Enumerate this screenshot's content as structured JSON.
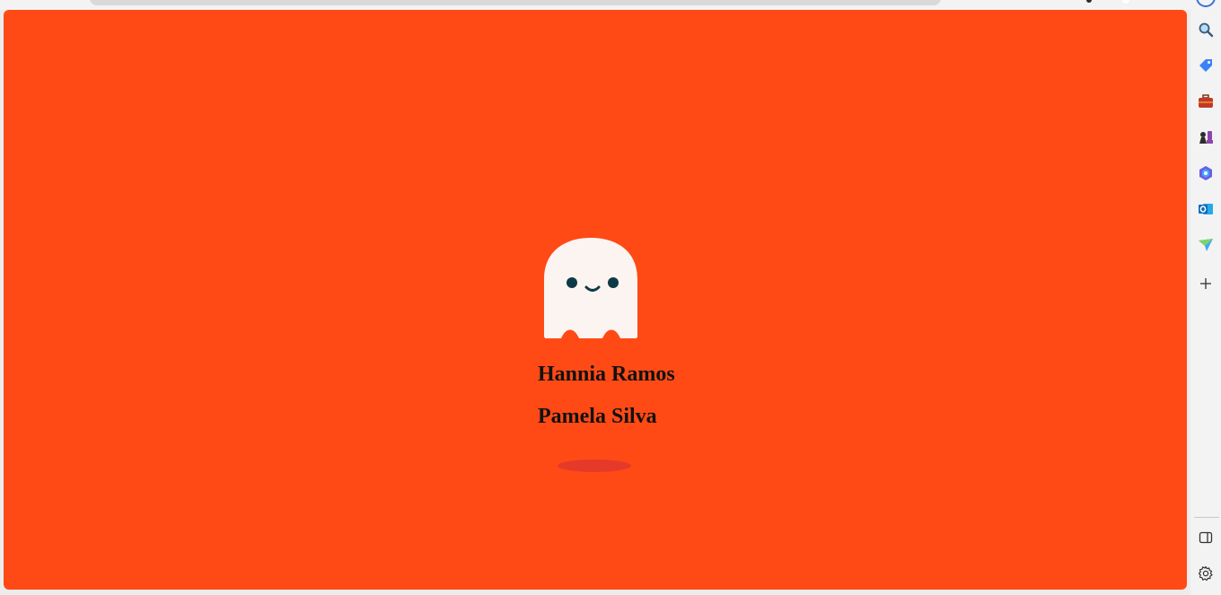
{
  "page": {
    "background_color": "#ff4a16",
    "ghost_icon": "ghost-icon"
  },
  "names": {
    "first": "Hannia Ramos",
    "second": "Pamela Silva"
  },
  "sidebar": {
    "items": [
      {
        "name": "search-icon"
      },
      {
        "name": "tag-icon"
      },
      {
        "name": "briefcase-icon"
      },
      {
        "name": "chess-icon"
      },
      {
        "name": "copilot-icon"
      },
      {
        "name": "outlook-icon"
      },
      {
        "name": "send-icon"
      },
      {
        "name": "add-icon"
      },
      {
        "name": "split-view-icon"
      },
      {
        "name": "settings-icon"
      }
    ]
  }
}
